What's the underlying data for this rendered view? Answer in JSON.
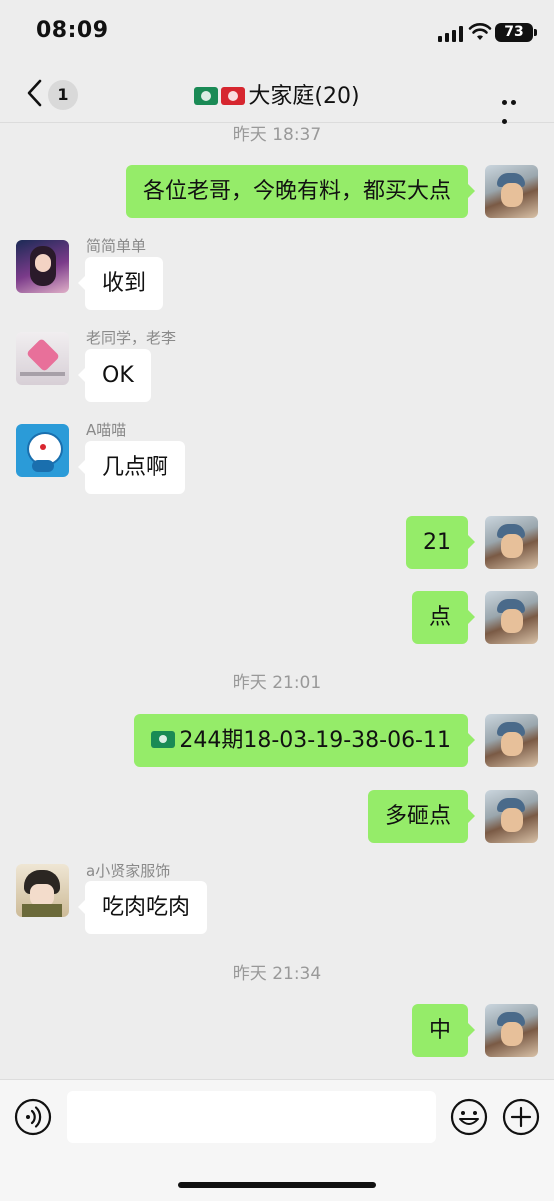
{
  "status_bar": {
    "time": "08:09",
    "battery": "73"
  },
  "nav": {
    "badge": "1",
    "title": "大家庭(20)"
  },
  "messages": [
    {
      "type": "timestamp",
      "text": "昨天 18:37"
    },
    {
      "type": "out",
      "text": "各位老哥，今晚有料，都买大点"
    },
    {
      "type": "in",
      "sender": "简简单单",
      "text": "收到"
    },
    {
      "type": "in",
      "sender": "老同学，老李",
      "text": "OK"
    },
    {
      "type": "in",
      "sender": "A喵喵",
      "text": "几点啊"
    },
    {
      "type": "out",
      "text": "21"
    },
    {
      "type": "out",
      "text": "点"
    },
    {
      "type": "timestamp",
      "text": "昨天 21:01"
    },
    {
      "type": "out",
      "text": "244期18-03-19-38-06-11"
    },
    {
      "type": "out",
      "text": "多砸点"
    },
    {
      "type": "in",
      "sender": "a小贤家服饰",
      "text": "吃肉吃肉"
    },
    {
      "type": "timestamp",
      "text": "昨天 21:34"
    },
    {
      "type": "out",
      "text": "中"
    }
  ],
  "colors": {
    "outgoing_bubble": "#95ec69",
    "incoming_bubble": "#ffffff",
    "background": "#ededed"
  },
  "icons": {
    "voice": "voice-icon",
    "emoji": "emoji-icon",
    "plus": "plus-icon",
    "back": "back-icon",
    "more": "more-icon"
  }
}
